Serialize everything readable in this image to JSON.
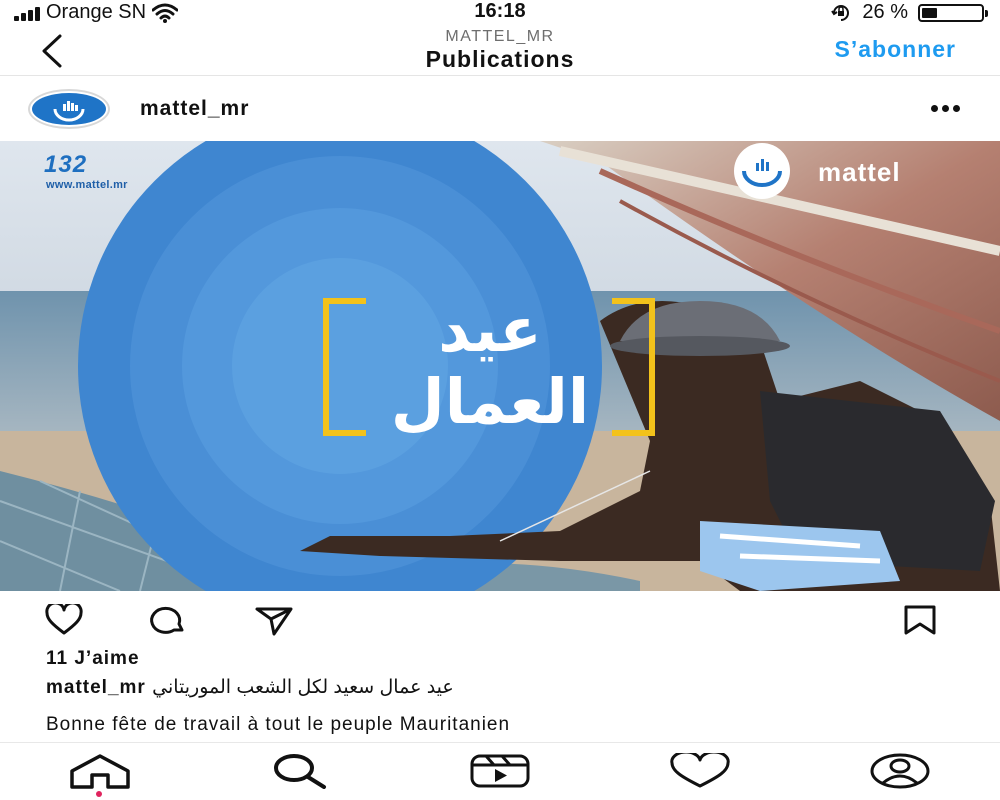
{
  "status_bar": {
    "carrier": "Orange SN",
    "time": "16:18",
    "battery_text": "26 %",
    "battery_level": 0.26,
    "icons": [
      "signal-icon",
      "wifi-icon",
      "orientation-lock-icon",
      "battery-icon"
    ]
  },
  "header": {
    "account_label": "MATTEL_MR",
    "title": "Publications",
    "follow_label": "S’abonner",
    "back_icon": "back-chevron-icon",
    "accent_color": "#1e9bf0"
  },
  "post": {
    "username": "mattel_mr",
    "image": {
      "shortcode": "132",
      "website": "www.mattel.mr",
      "brand": "mattel",
      "headline_line1": "عيد",
      "headline_line2": "العمال",
      "primary_color": "#3f86d0",
      "frame_color": "#f3c21b"
    },
    "actions": [
      "like-icon",
      "comment-icon",
      "share-icon",
      "save-icon"
    ],
    "likes": "11 J’aime",
    "caption_user": "mattel_mr",
    "caption_text": "عيد عمال سعيد لكل الشعب الموريتاني",
    "caption_translation": "Bonne fête de travail à tout le peuple Mauritanien"
  },
  "bottom_nav": {
    "items": [
      "home-icon",
      "search-icon",
      "reels-icon",
      "activity-icon",
      "profile-icon"
    ],
    "active": "home-icon",
    "active_dot_color": "#e0245e"
  }
}
